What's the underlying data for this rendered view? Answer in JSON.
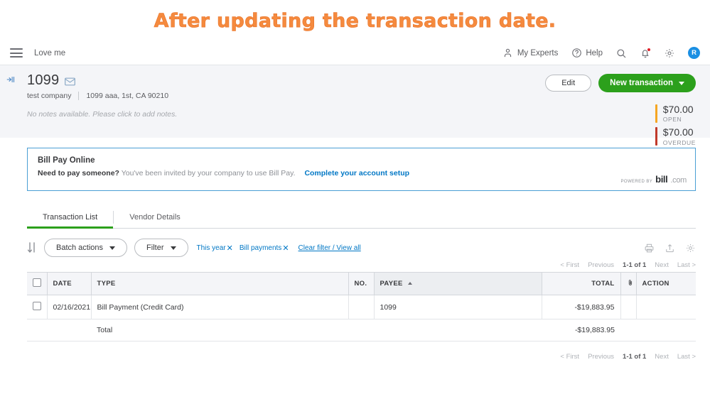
{
  "annotation": {
    "text": "After updating the transaction date."
  },
  "topnav": {
    "brand": "Love me",
    "my_experts": "My Experts",
    "help": "Help",
    "avatar_initial": "R"
  },
  "vendor": {
    "name": "1099",
    "company": "test company",
    "address": "1099 aaa, 1st, CA 90210",
    "notes_placeholder": "No notes available. Please click to add notes.",
    "edit_label": "Edit",
    "new_transaction_label": "New transaction",
    "stats": [
      {
        "amount": "$70.00",
        "label": "OPEN",
        "color": "#f5a623"
      },
      {
        "amount": "$70.00",
        "label": "OVERDUE",
        "color": "#c0392b"
      }
    ]
  },
  "billpay": {
    "title": "Bill Pay Online",
    "prompt": "Need to pay someone?",
    "message": "You've been invited by your company to use Bill Pay.",
    "link": "Complete your account setup",
    "powered_by": "POWERED BY",
    "brand_bold": "bill",
    "brand_light": ".com"
  },
  "tabs": [
    {
      "label": "Transaction List",
      "active": true
    },
    {
      "label": "Vendor Details",
      "active": false
    }
  ],
  "toolbar": {
    "batch_actions": "Batch actions",
    "filter": "Filter",
    "chips": [
      {
        "label": "This year"
      },
      {
        "label": "Bill payments"
      }
    ],
    "clear_filter": "Clear filter / View all"
  },
  "pagination": {
    "first": "< First",
    "previous": "Previous",
    "current": "1-1 of 1",
    "next": "Next",
    "last": "Last >"
  },
  "table": {
    "columns": {
      "date": "DATE",
      "type": "TYPE",
      "no": "NO.",
      "payee": "PAYEE",
      "total": "TOTAL",
      "action": "ACTION"
    },
    "rows": [
      {
        "date": "02/16/2021",
        "type": "Bill Payment (Credit Card)",
        "no": "",
        "payee": "1099",
        "total": "-$19,883.95",
        "action": ""
      }
    ],
    "total_label": "Total",
    "total_value": "-$19,883.95"
  }
}
